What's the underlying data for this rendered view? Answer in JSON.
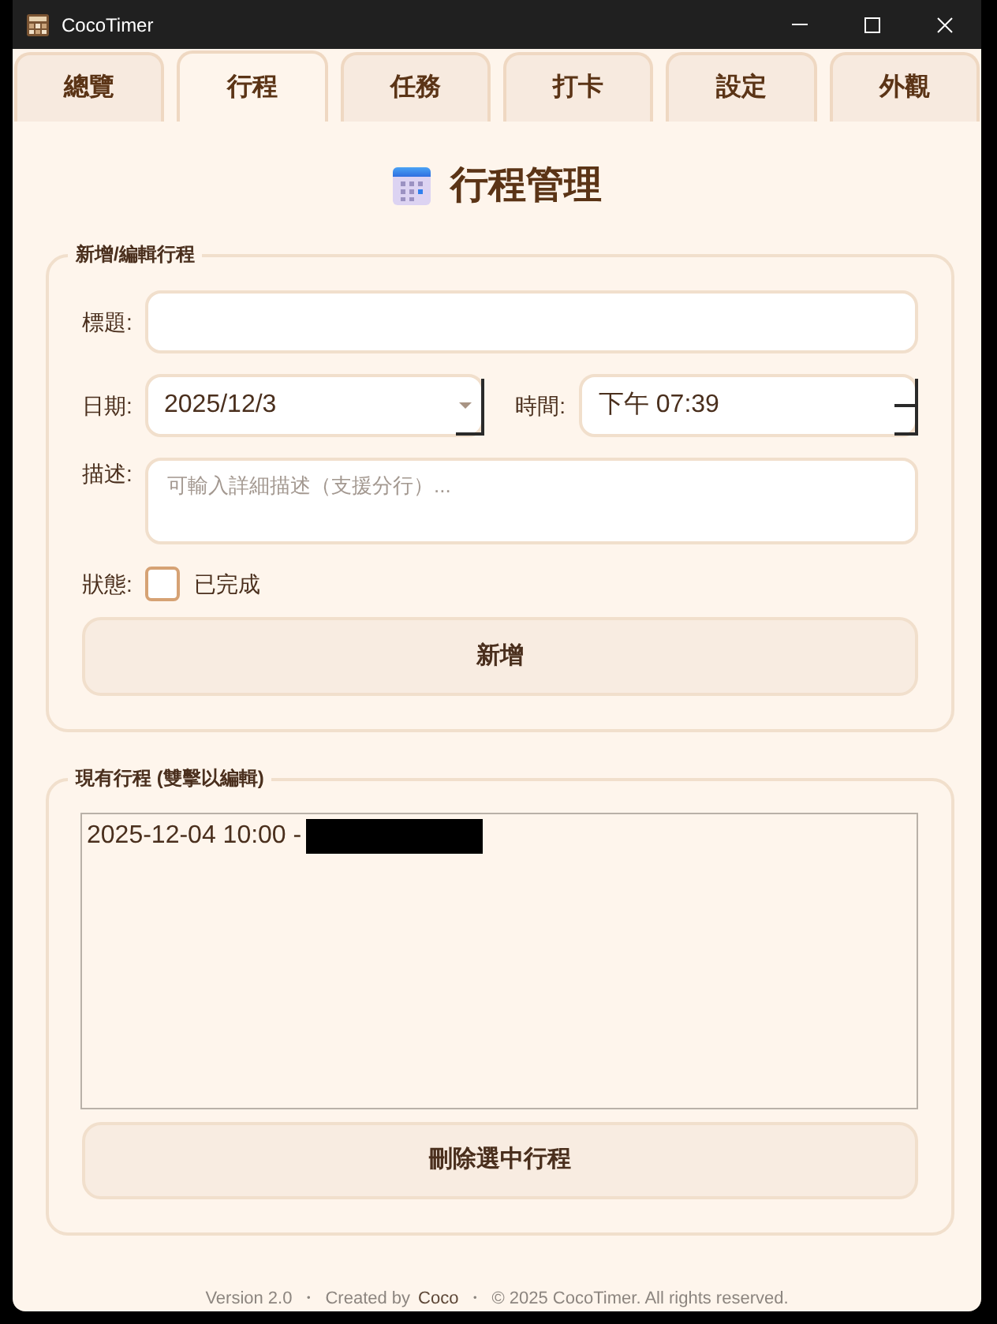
{
  "window": {
    "title": "CocoTimer"
  },
  "tabs": [
    {
      "label": "總覽",
      "selected": false
    },
    {
      "label": "行程",
      "selected": true
    },
    {
      "label": "任務",
      "selected": false
    },
    {
      "label": "打卡",
      "selected": false
    },
    {
      "label": "設定",
      "selected": false
    },
    {
      "label": "外觀",
      "selected": false
    }
  ],
  "heading": {
    "title": "行程管理"
  },
  "editor": {
    "legend": "新增/編輯行程",
    "title_field": {
      "label": "標題:"
    },
    "date_field": {
      "label": "日期:",
      "value": "2025/12/3"
    },
    "time_field": {
      "label": "時間:",
      "value": "下午 07:39"
    },
    "description_field": {
      "label": "描述:",
      "placeholder": "可輸入詳細描述（支援分行）..."
    },
    "status": {
      "label": "狀態:",
      "checkbox_label": "已完成",
      "checked": false
    },
    "submit_button": "新增"
  },
  "schedule_list": {
    "legend": "現有行程 (雙擊以編輯)",
    "items": [
      {
        "text": "2025-12-04 10:00 -",
        "redacted": true,
        "selected": false
      }
    ],
    "delete_button": "刪除選中行程"
  },
  "footer": {
    "parts": [
      {
        "kind": "text",
        "text": "Version 2.0"
      },
      {
        "kind": "separator",
        "text": "・"
      },
      {
        "kind": "text",
        "text": "Created by"
      },
      {
        "kind": "link",
        "text": "Coco"
      },
      {
        "kind": "separator",
        "text": "・"
      },
      {
        "kind": "text",
        "text": "© 2025 CocoTimer. All rights reserved."
      }
    ]
  }
}
